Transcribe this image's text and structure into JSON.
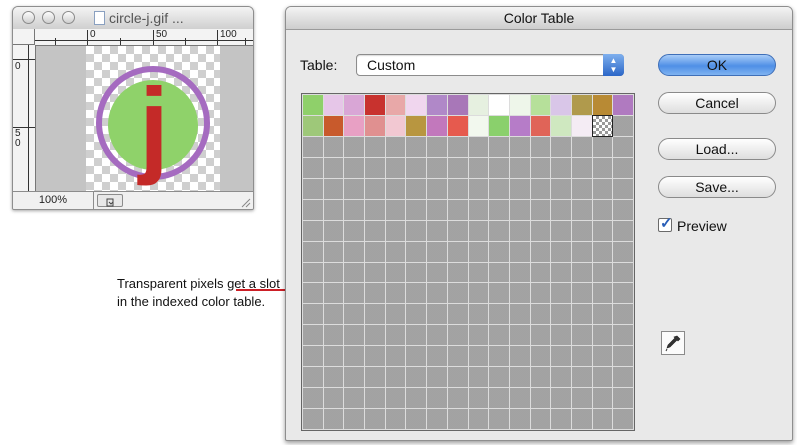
{
  "document_window": {
    "title": "circle-j.gif ...",
    "ruler_top_labels": [
      "0",
      "50",
      "100"
    ],
    "ruler_left_labels": [
      "0",
      "5\n0"
    ],
    "image_letter": "j",
    "zoom": "100%"
  },
  "callout": {
    "text": "Transparent pixels get a slot in the indexed color table."
  },
  "color_table_dialog": {
    "title": "Color Table",
    "table_label": "Table:",
    "table_value": "Custom",
    "buttons": {
      "ok": "OK",
      "cancel": "Cancel",
      "load": "Load...",
      "save": "Save..."
    },
    "preview_label": "Preview",
    "preview_checked": true,
    "palette": [
      "#8fd06a",
      "#e6c6e8",
      "#d9a6d6",
      "#c8322e",
      "#e8a8a8",
      "#f0d6ee",
      "#b088c8",
      "#a877b8",
      "#e6f0e0",
      "#ffffff",
      "#eef6ea",
      "#b6e09a",
      "#d9c6e8",
      "#b09a4c",
      "#b88a34",
      "#b07ac0",
      "#9ec879",
      "#c85a2c",
      "#e8a0c4",
      "#e09090",
      "#f2c8d2",
      "#b89640",
      "#c278bc",
      "#e65a4e",
      "#f2f8ee",
      "#8ad06c",
      "#b67cc8",
      "#e06458",
      "#cfe8c0",
      "#f4ecf4",
      "transparent"
    ]
  },
  "colors": {
    "arrow": "#cc1f26",
    "accent": "#4f8fe6",
    "image_green": "#8fd26a",
    "image_purple": "#a56bc0",
    "image_red": "#c42a28"
  }
}
